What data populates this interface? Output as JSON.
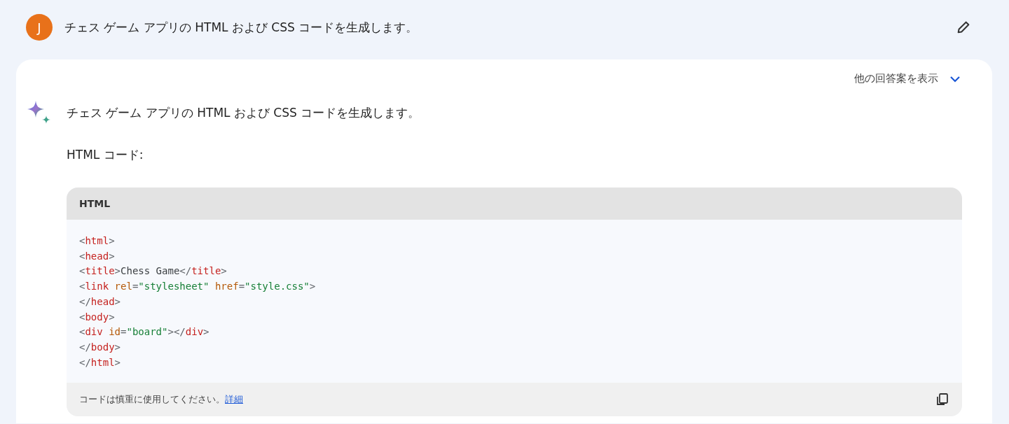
{
  "prompt": {
    "avatar": "J",
    "text": "チェス ゲーム アプリの HTML および CSS コードを生成します。"
  },
  "response": {
    "drafts_label": "他の回答案を表示",
    "drafts_expanded": false,
    "intro": "チェス ゲーム アプリの HTML および CSS コードを生成します。",
    "heading": "HTML コード:",
    "code_block": {
      "language": "HTML",
      "lines": [
        [
          {
            "kind": "punct",
            "text": "<"
          },
          {
            "kind": "tag",
            "text": "html"
          },
          {
            "kind": "punct",
            "text": ">"
          }
        ],
        [
          {
            "kind": "punct",
            "text": "<"
          },
          {
            "kind": "tag",
            "text": "head"
          },
          {
            "kind": "punct",
            "text": ">"
          }
        ],
        [
          {
            "kind": "punct",
            "text": "<"
          },
          {
            "kind": "tag",
            "text": "title"
          },
          {
            "kind": "punct",
            "text": ">"
          },
          {
            "kind": "text",
            "text": "Chess Game"
          },
          {
            "kind": "punct",
            "text": "</"
          },
          {
            "kind": "tag",
            "text": "title"
          },
          {
            "kind": "punct",
            "text": ">"
          }
        ],
        [
          {
            "kind": "punct",
            "text": "<"
          },
          {
            "kind": "tag",
            "text": "link"
          },
          {
            "kind": "attr",
            "text": " rel"
          },
          {
            "kind": "punct",
            "text": "="
          },
          {
            "kind": "string",
            "text": "\"stylesheet\""
          },
          {
            "kind": "attr",
            "text": " href"
          },
          {
            "kind": "punct",
            "text": "="
          },
          {
            "kind": "string",
            "text": "\"style.css\""
          },
          {
            "kind": "punct",
            "text": ">"
          }
        ],
        [
          {
            "kind": "punct",
            "text": "</"
          },
          {
            "kind": "tag",
            "text": "head"
          },
          {
            "kind": "punct",
            "text": ">"
          }
        ],
        [
          {
            "kind": "punct",
            "text": "<"
          },
          {
            "kind": "tag",
            "text": "body"
          },
          {
            "kind": "punct",
            "text": ">"
          }
        ],
        [
          {
            "kind": "punct",
            "text": "<"
          },
          {
            "kind": "tag",
            "text": "div"
          },
          {
            "kind": "attr",
            "text": " id"
          },
          {
            "kind": "punct",
            "text": "="
          },
          {
            "kind": "string",
            "text": "\"board\""
          },
          {
            "kind": "punct",
            "text": "></"
          },
          {
            "kind": "tag",
            "text": "div"
          },
          {
            "kind": "punct",
            "text": ">"
          }
        ],
        [
          {
            "kind": "punct",
            "text": "</"
          },
          {
            "kind": "tag",
            "text": "body"
          },
          {
            "kind": "punct",
            "text": ">"
          }
        ],
        [
          {
            "kind": "punct",
            "text": "</"
          },
          {
            "kind": "tag",
            "text": "html"
          },
          {
            "kind": "punct",
            "text": ">"
          }
        ]
      ],
      "notice": "コードは慎重に使用してください。",
      "notice_link": "詳細"
    }
  }
}
